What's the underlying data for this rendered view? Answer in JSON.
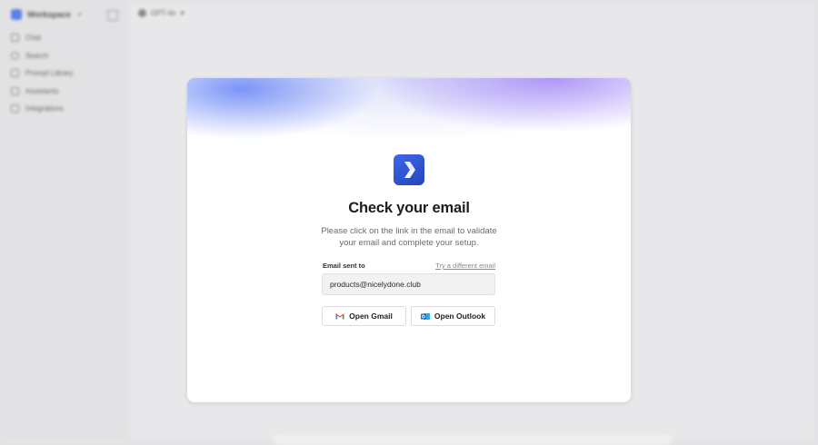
{
  "sidebar": {
    "workspace_name": "Workspace",
    "items": [
      {
        "label": "Chat",
        "icon": "chat-icon"
      },
      {
        "label": "Search",
        "icon": "search-icon"
      },
      {
        "label": "Prompt Library",
        "icon": "library-icon"
      },
      {
        "label": "Assistants",
        "icon": "assistants-icon"
      },
      {
        "label": "Integrations",
        "icon": "integrations-icon"
      }
    ]
  },
  "header": {
    "model_label": "GPT-4o"
  },
  "modal": {
    "title": "Check your email",
    "description": "Please click on the link in the email to validate your email and complete your setup.",
    "email_label": "Email sent to",
    "alt_link": "Try a different email",
    "email_value": "products@nicelydone.club",
    "gmail_button": "Open Gmail",
    "outlook_button": "Open Outlook"
  },
  "colors": {
    "brand": "#3f67ea",
    "glow_blue": "#6684f5",
    "glow_violet": "#9678f5"
  }
}
